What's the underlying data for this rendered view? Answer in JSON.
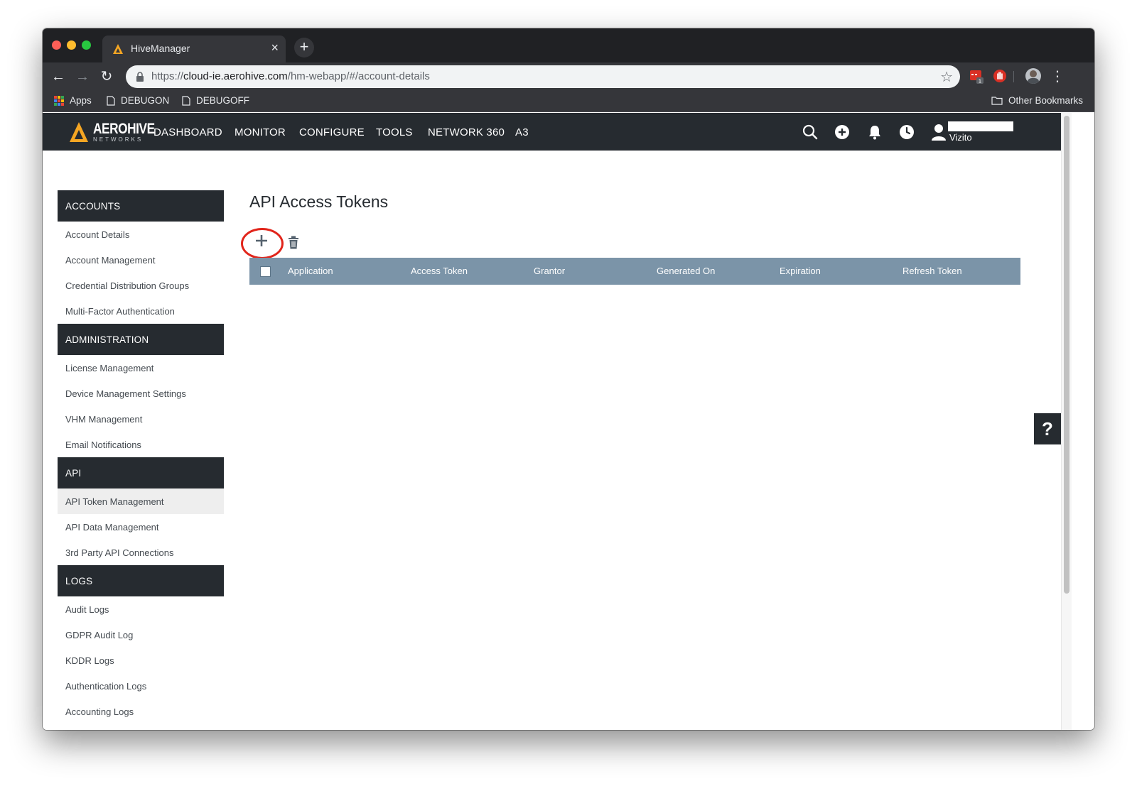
{
  "browser": {
    "tab_title": "HiveManager",
    "tab_close": "×",
    "new_tab": "+",
    "url_scheme": "https://",
    "url_host": "cloud-ie.aerohive.com",
    "url_path": "/hm-webapp/#/account-details",
    "bookmarks": {
      "apps": "Apps",
      "debugon": "DEBUGON",
      "debugoff": "DEBUGOFF",
      "other": "Other Bookmarks"
    },
    "extension_badge": "1"
  },
  "app": {
    "logo_top": "AEROHIVE",
    "logo_bottom": "NETWORKS",
    "nav": [
      "DASHBOARD",
      "MONITOR",
      "CONFIGURE",
      "TOOLS",
      "NETWORK 360",
      "A3"
    ],
    "user_name": "Vizito"
  },
  "sidebar": {
    "sections": [
      {
        "title": "ACCOUNTS",
        "items": [
          "Account Details",
          "Account Management",
          "Credential Distribution Groups",
          "Multi-Factor Authentication"
        ]
      },
      {
        "title": "ADMINISTRATION",
        "items": [
          "License Management",
          "Device Management Settings",
          "VHM Management",
          "Email Notifications"
        ]
      },
      {
        "title": "API",
        "items": [
          "API Token Management",
          "API Data Management",
          "3rd Party API Connections"
        ]
      },
      {
        "title": "LOGS",
        "items": [
          "Audit Logs",
          "GDPR Audit Log",
          "KDDR Logs",
          "Authentication Logs",
          "Accounting Logs"
        ]
      }
    ],
    "active_item": "API Token Management"
  },
  "main": {
    "title": "API Access Tokens",
    "columns": [
      "Application",
      "Access Token",
      "Grantor",
      "Generated On",
      "Expiration",
      "Refresh Token"
    ],
    "help_label": "?"
  },
  "colors": {
    "nav_bg": "#262b30",
    "table_header_bg": "#7b94a8",
    "highlight": "#e1251b",
    "logo_accent": "#f5a623"
  }
}
